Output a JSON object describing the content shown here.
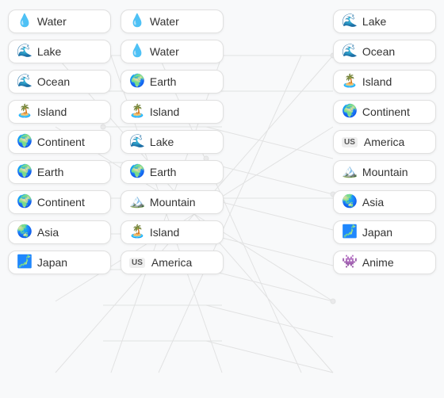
{
  "colors": {
    "background": "#f8f9fa",
    "card_bg": "#ffffff",
    "card_border": "#e0e0e0"
  },
  "left_column": [
    {
      "id": "lc1",
      "icon": "💧",
      "label": "Water"
    },
    {
      "id": "lc2",
      "icon": "🌊",
      "label": "Lake"
    },
    {
      "id": "lc3",
      "icon": "🌊",
      "label": "Ocean"
    },
    {
      "id": "lc4",
      "icon": "🏝️",
      "label": "Island"
    },
    {
      "id": "lc5",
      "icon": "🌍",
      "label": "Continent"
    },
    {
      "id": "lc6",
      "icon": "🌍",
      "label": "Earth"
    },
    {
      "id": "lc7",
      "icon": "🌍",
      "label": "Continent"
    },
    {
      "id": "lc8",
      "icon": "🌏",
      "label": "Asia"
    },
    {
      "id": "lc9",
      "icon": "🗾",
      "label": "Japan"
    }
  ],
  "mid_column": [
    {
      "id": "mc1",
      "icon": "💧",
      "label": "Water"
    },
    {
      "id": "mc2",
      "icon": "💧",
      "label": "Water"
    },
    {
      "id": "mc3",
      "icon": "🌍",
      "label": "Earth"
    },
    {
      "id": "mc4",
      "icon": "🏝️",
      "label": "Island"
    },
    {
      "id": "mc5",
      "icon": "🌊",
      "label": "Lake"
    },
    {
      "id": "mc6",
      "icon": "🌍",
      "label": "Earth"
    },
    {
      "id": "mc7",
      "icon": "🏔️",
      "label": "Mountain"
    },
    {
      "id": "mc8",
      "icon": "🏝️",
      "label": "Island"
    },
    {
      "id": "mc9",
      "icon": "us",
      "label": "America"
    }
  ],
  "right_column": [
    {
      "id": "rc1",
      "icon": "🌊",
      "label": "Lake"
    },
    {
      "id": "rc2",
      "icon": "🌊",
      "label": "Ocean"
    },
    {
      "id": "rc3",
      "icon": "🏝️",
      "label": "Island"
    },
    {
      "id": "rc4",
      "icon": "🌍",
      "label": "Continent"
    },
    {
      "id": "rc5",
      "icon": "us",
      "label": "America"
    },
    {
      "id": "rc6",
      "icon": "🏔️",
      "label": "Mountain"
    },
    {
      "id": "rc7",
      "icon": "🌏",
      "label": "Asia"
    },
    {
      "id": "rc8",
      "icon": "🗾",
      "label": "Japan"
    },
    {
      "id": "rc9",
      "icon": "👾",
      "label": "Anime"
    }
  ]
}
